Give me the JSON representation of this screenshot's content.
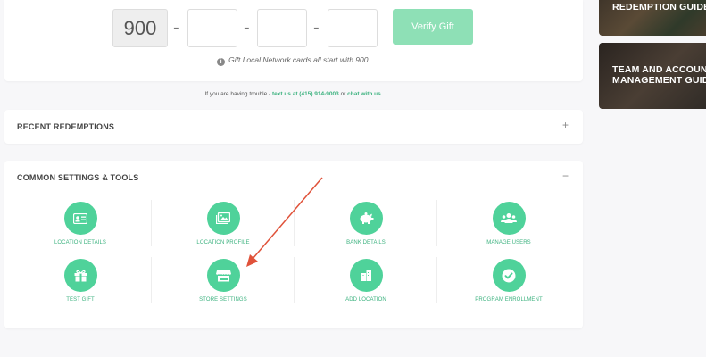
{
  "verify": {
    "prefix": "900",
    "dash": "-",
    "button_label": "Verify Gift",
    "hint": "Gift Local Network cards all start with 900."
  },
  "trouble": {
    "prefix": "If you are having trouble - ",
    "text_link": "text us at (415) 914-9003",
    "or": " or ",
    "chat_link": "chat with us."
  },
  "recent": {
    "title": "RECENT REDEMPTIONS",
    "toggle": "+"
  },
  "settings": {
    "title": "COMMON SETTINGS & TOOLS",
    "toggle": "−",
    "tools": [
      {
        "label": "LOCATION DETAILS",
        "icon": "id-card-icon"
      },
      {
        "label": "LOCATION PROFILE",
        "icon": "image-icon"
      },
      {
        "label": "BANK DETAILS",
        "icon": "piggy-bank-icon"
      },
      {
        "label": "MANAGE USERS",
        "icon": "users-icon"
      },
      {
        "label": "TEST GIFT",
        "icon": "gift-icon"
      },
      {
        "label": "STORE SETTINGS",
        "icon": "store-icon"
      },
      {
        "label": "ADD LOCATION",
        "icon": "building-icon"
      },
      {
        "label": "PROGRAM ENROLLMENT",
        "icon": "check-circle-icon"
      }
    ]
  },
  "sidebar": {
    "promo_1": "REDEMPTION GUIDE",
    "promo_2_line1": "TEAM AND ACCOUNT",
    "promo_2_line2": "MANAGEMENT GUIDE"
  },
  "colors": {
    "accent": "#4fd29a",
    "button_disabled": "#8ee0b6",
    "annotation_arrow": "#e0523a"
  }
}
